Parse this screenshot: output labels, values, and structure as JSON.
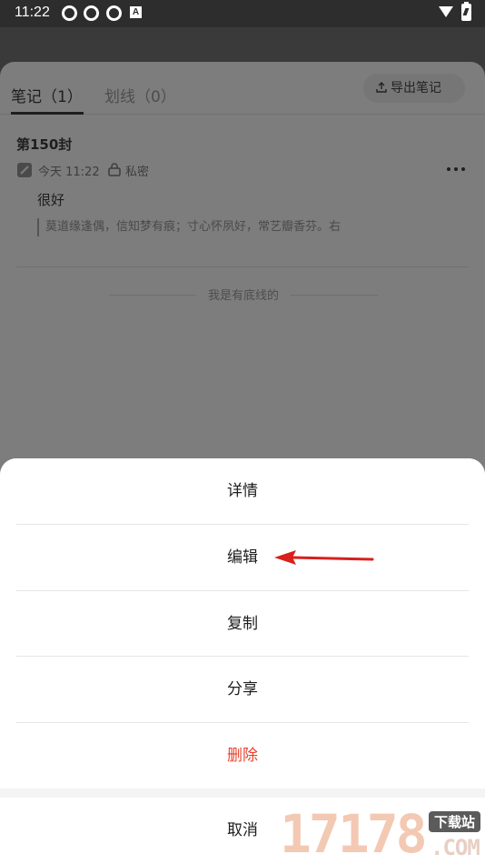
{
  "status_bar": {
    "time": "11:22",
    "badge": "A"
  },
  "note_page": {
    "tabs": [
      {
        "label": "笔记（1）"
      },
      {
        "label": "划线（0）"
      }
    ],
    "export_label": "导出笔记",
    "note": {
      "title": "第150封",
      "time": "今天 11:22",
      "privacy": "私密",
      "body": "很好",
      "quote": "莫道缘逢偶，信知梦有痕；寸心怀夙好，常艺瓣香芬。右"
    },
    "end_text": "我是有底线的"
  },
  "action_sheet": {
    "items": [
      {
        "label": "详情"
      },
      {
        "label": "编辑"
      },
      {
        "label": "复制"
      },
      {
        "label": "分享"
      },
      {
        "label": "删除"
      }
    ],
    "cancel_label": "取消"
  },
  "watermark": {
    "number": "17178",
    "tag": "下载站",
    "domain": ".COM"
  },
  "colors": {
    "danger": "#e8412c",
    "annotation_arrow": "#d8201c"
  }
}
